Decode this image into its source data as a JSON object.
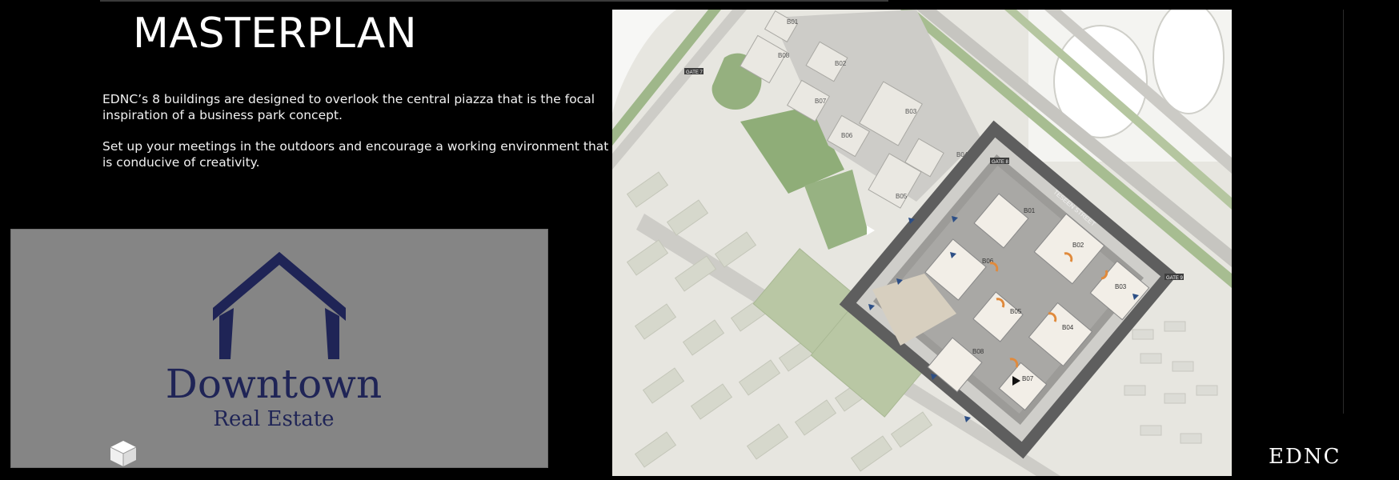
{
  "heading": {
    "title": "MASTERPLAN"
  },
  "intro": {
    "paragraph_1": "EDNC’s 8 buildings are designed to overlook the central piazza that is the focal inspiration of a business park concept.",
    "paragraph_2": "Set up your meetings in the outdoors and encourage a working environment that is conducive of creativity."
  },
  "brand": {
    "name_line_1": "Downtown",
    "name_line_2": "Real Estate",
    "primary_color": "#1f2456",
    "panel_color": "#858585"
  },
  "map": {
    "street_label": "TESEEN STREET",
    "gates": [
      "GATE 7",
      "GATE 8",
      "GATE 9"
    ],
    "existing_buildings": [
      "B01",
      "B02",
      "B03",
      "B04",
      "B05",
      "B06",
      "B07",
      "B08"
    ],
    "project_buildings": [
      "B01",
      "B02",
      "B03",
      "B04",
      "B05",
      "B06",
      "B07",
      "B08"
    ]
  },
  "footer": {
    "logo_text": "EDNC"
  }
}
